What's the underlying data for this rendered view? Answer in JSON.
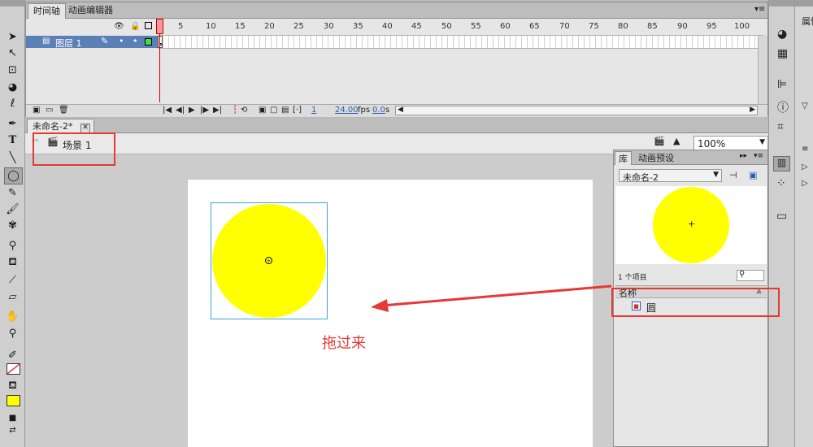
{
  "timeline": {
    "tabs": [
      "时间轴",
      "动画编辑器"
    ],
    "layer_name": "图层 1",
    "ruler_numbers": [
      "1",
      "5",
      "10",
      "15",
      "20",
      "25",
      "30",
      "35",
      "40",
      "45",
      "50",
      "55",
      "60",
      "65",
      "70",
      "75",
      "80",
      "85",
      "90",
      "95",
      "100"
    ],
    "current_frame": "1",
    "fps": "24.00",
    "fps_unit": "fps",
    "time": "0.0",
    "time_unit": "s"
  },
  "document": {
    "tab_label": "未命名-2*",
    "scene_label": "场景 1",
    "zoom": "100%"
  },
  "library": {
    "tabs": [
      "库",
      "动画预设"
    ],
    "doc_select": "未命名-2",
    "item_count": "1 个项目",
    "column_header": "名称",
    "items": [
      {
        "name": "圆"
      }
    ]
  },
  "annotation": {
    "text": "拖过来"
  },
  "right_dock": {
    "panel_title": "属性"
  },
  "colors": {
    "accent_red": "#e53935",
    "fill_yellow": "#ffff00",
    "layer_blue": "#5b7fb7",
    "selection_cyan": "#3aa4dc"
  }
}
